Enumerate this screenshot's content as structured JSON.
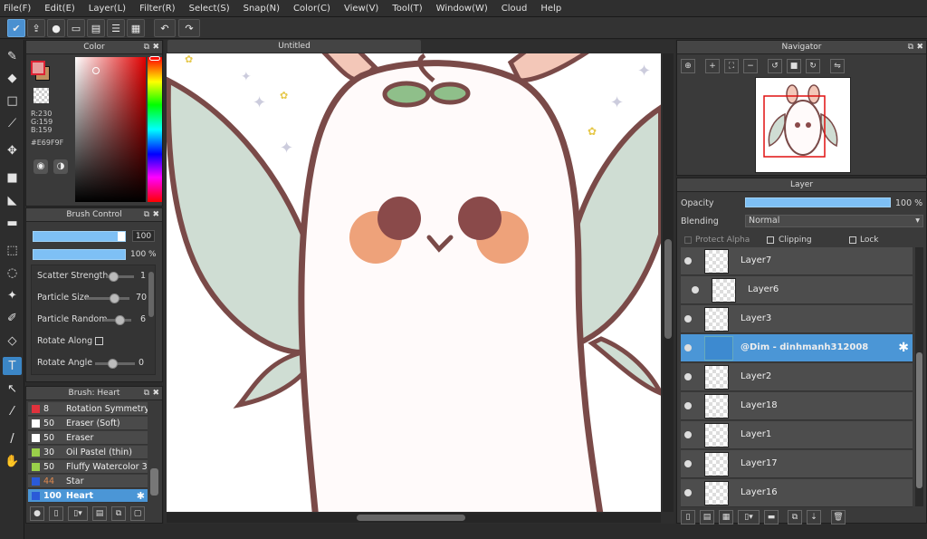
{
  "menu": [
    "File(F)",
    "Edit(E)",
    "Layer(L)",
    "Filter(R)",
    "Select(S)",
    "Snap(N)",
    "Color(C)",
    "View(V)",
    "Tool(T)",
    "Window(W)",
    "Cloud",
    "Help"
  ],
  "color_panel": {
    "title": "Color",
    "rgb": {
      "r": "R:230",
      "g": "G:159",
      "b": "B:159"
    },
    "hex": "#E69F9F",
    "foreground": "#E69F9F",
    "background": "#C09060"
  },
  "brush_control": {
    "title": "Brush Control",
    "size_value": "100",
    "opacity_value": "100 %",
    "params": [
      {
        "label": "Scatter Strength",
        "value": "1",
        "level": 0.5
      },
      {
        "label": "Particle Size",
        "value": "70",
        "level": 0.68
      },
      {
        "label": "Particle Random",
        "value": "6",
        "level": 0.75
      },
      {
        "label": "Rotate Along",
        "value": "",
        "level": null
      },
      {
        "label": "Rotate Angle",
        "value": "0",
        "level": 0.5
      }
    ]
  },
  "brush_list": {
    "title": "Brush: Heart",
    "items": [
      {
        "size": "8",
        "name": "Rotation Symmetry P",
        "color": "#e0323c"
      },
      {
        "size": "50",
        "name": "Eraser (Soft)",
        "color": "#ffffff"
      },
      {
        "size": "50",
        "name": "Eraser",
        "color": "#ffffff"
      },
      {
        "size": "30",
        "name": "Oil Pastel (thin)",
        "color": "#9ad04a"
      },
      {
        "size": "50",
        "name": "Fluffy Watercolor 3",
        "color": "#9ad04a"
      },
      {
        "size": "44",
        "name": "Star",
        "color": "#2a5ad8"
      },
      {
        "size": "100",
        "name": "Heart",
        "color": "#2a5ad8"
      }
    ]
  },
  "document": {
    "tab": "Untitled"
  },
  "navigator": {
    "title": "Navigator"
  },
  "layer_panel": {
    "title": "Layer",
    "opacity_label": "Opacity",
    "opacity_value": "100 %",
    "blending_label": "Blending",
    "blending_value": "Normal",
    "protect_alpha": "Protect Alpha",
    "clipping": "Clipping",
    "lock": "Lock",
    "layers": [
      {
        "name": "Layer7"
      },
      {
        "name": "Layer6"
      },
      {
        "name": "Layer3"
      },
      {
        "name": "@Dim - dinhmanh312008"
      },
      {
        "name": "Layer2"
      },
      {
        "name": "Layer18"
      },
      {
        "name": "Layer1"
      },
      {
        "name": "Layer17"
      },
      {
        "name": "Layer16"
      }
    ]
  }
}
